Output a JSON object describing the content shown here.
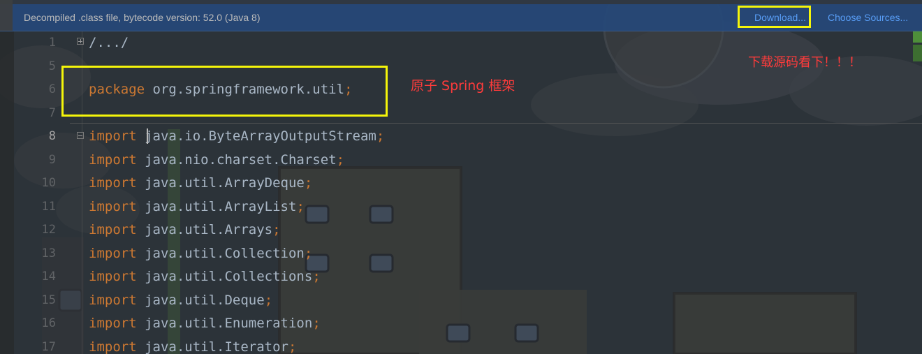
{
  "banner": {
    "message": "Decompiled .class file, bytecode version: 52.0 (Java 8)",
    "download_label": "Download...",
    "choose_sources_label": "Choose Sources..."
  },
  "colors": {
    "keyword": "#cc7832",
    "identifier": "#a9b7c6",
    "link": "#589df6",
    "annotation_box": "#f5f50a",
    "annotation_text": "#ff3b3b",
    "line_number": "#606366"
  },
  "gutter": {
    "line_numbers": [
      "1",
      "5",
      "6",
      "7",
      "8",
      "9",
      "10",
      "11",
      "12",
      "13",
      "14",
      "15",
      "16",
      "17"
    ]
  },
  "code": {
    "folded_header": "/.../",
    "package_keyword": "package",
    "package_name": " org.springframework.util",
    "import_keyword": "import",
    "imports": [
      "java.io.ByteArrayOutputStream",
      "java.nio.charset.Charset",
      "java.util.ArrayDeque",
      "java.util.ArrayList",
      "java.util.Arrays",
      "java.util.Collection",
      "java.util.Collections",
      "java.util.Deque",
      "java.util.Enumeration",
      "java.util.Iterator"
    ],
    "semicolon": ";"
  },
  "annotations": {
    "spring_note": "原子 Spring 框架",
    "download_note": "下载源码看下！！！"
  },
  "icons": {
    "fold_collapsed": "fold-plus-icon",
    "fold_expanded": "fold-minus-icon"
  }
}
